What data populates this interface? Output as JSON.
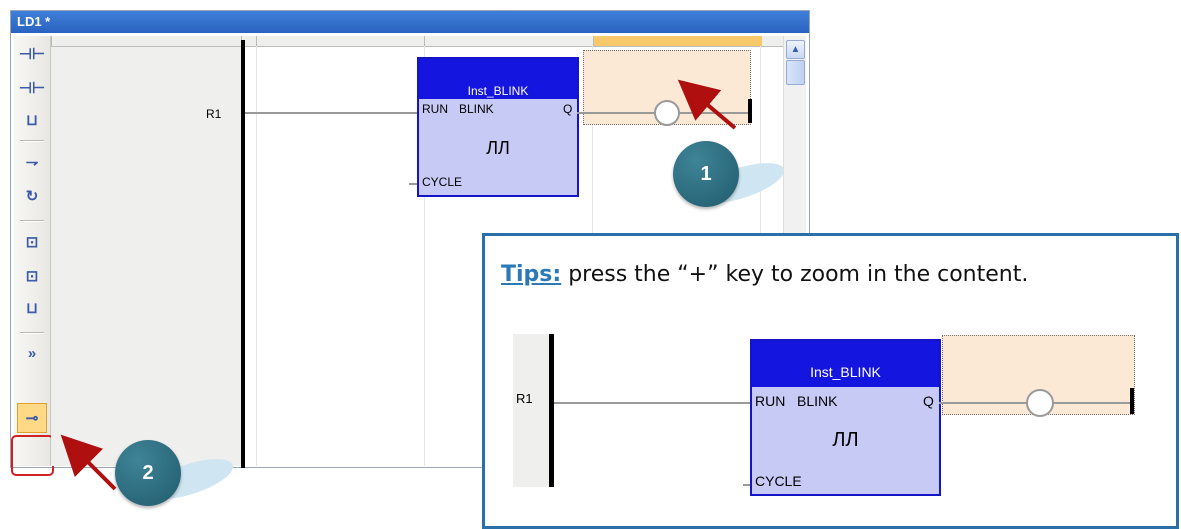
{
  "window": {
    "title": "LD1 *"
  },
  "toolbar": {
    "items": [
      {
        "name": "contact-on-left",
        "glyph": "⊣⊢"
      },
      {
        "name": "contact-on-right",
        "glyph": "⊣⊢"
      },
      {
        "name": "parallel-contact",
        "glyph": "⊔"
      },
      {
        "name": "jump",
        "glyph": "⇁"
      },
      {
        "name": "return",
        "glyph": "↻"
      },
      {
        "name": "fb-on-left",
        "glyph": "⊡"
      },
      {
        "name": "fb-on-right",
        "glyph": "⊡"
      },
      {
        "name": "parallel-fb",
        "glyph": "⊔"
      },
      {
        "name": "move-right",
        "glyph": "»"
      },
      {
        "name": "coil",
        "glyph": "⊸"
      }
    ]
  },
  "diagram": {
    "rung_label": "R1",
    "block": {
      "instance": "Inst_BLINK",
      "type": "BLINK",
      "in1": "RUN",
      "out": "Q",
      "in2": "CYCLE",
      "symbol": "ЛЛ"
    }
  },
  "callouts": {
    "one": "1",
    "two": "2"
  },
  "tips": {
    "label": "Tips:",
    "text": "press the “+”  key to zoom in the content."
  },
  "colors": {
    "fb_header": "#1515e0",
    "fb_body": "#c8caf6",
    "selected_cell": "#fbe9d6",
    "tips_border": "#2a6fa8"
  }
}
